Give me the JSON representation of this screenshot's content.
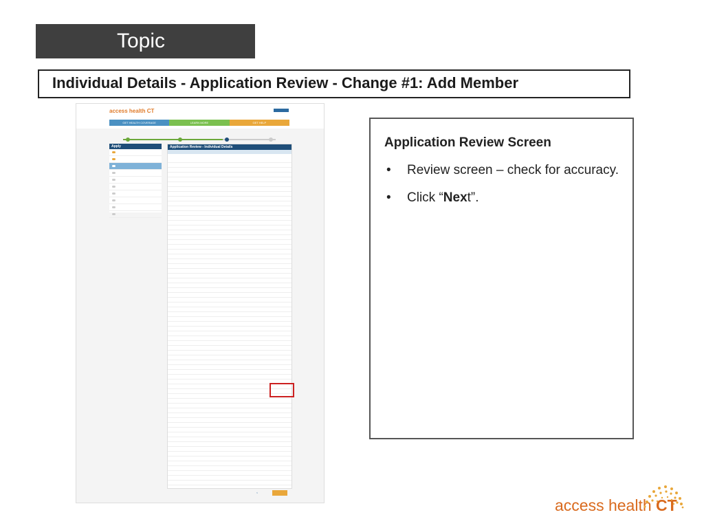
{
  "topic_label": "Topic",
  "slide_title": "Individual Details - Application Review - Change #1:  Add Member",
  "screenshot": {
    "navbar": [
      {
        "label": "GET HEALTH COVERAGE",
        "color": "#4a90c2"
      },
      {
        "label": "LEARN MORE",
        "color": "#7bc04f"
      },
      {
        "label": "GET HELP",
        "color": "#e9a73a"
      }
    ],
    "sidebar_header": "Apply",
    "panel_title": "Application Review - Individual Details"
  },
  "info": {
    "heading": "Application Review Screen",
    "bullets": [
      {
        "text": "Review screen – check for accuracy."
      },
      {
        "pre": "Click “",
        "bold": "Nex",
        "post": "t”."
      }
    ]
  },
  "brand": {
    "name_prefix": "access health ",
    "name_bold": "CT",
    "color": "#d96a1e"
  }
}
